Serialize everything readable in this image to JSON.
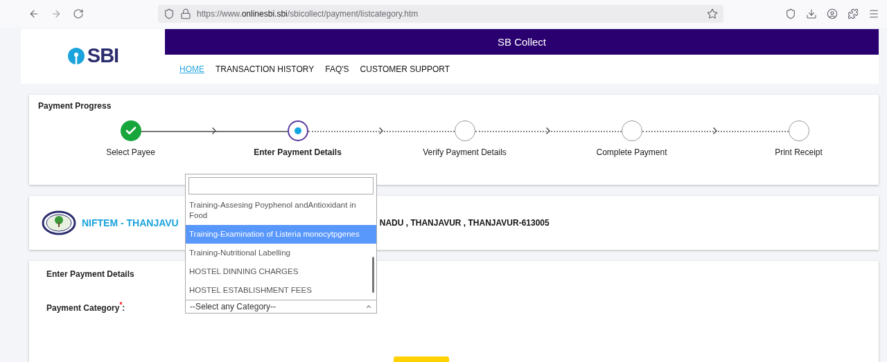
{
  "browser": {
    "url_prefix": "https://www.",
    "url_host": "onlinesbi.sbi",
    "url_path": "/sbicollect/payment/listcategory.htm"
  },
  "header": {
    "logo_text": "SBI",
    "banner_title": "SB Collect",
    "nav": [
      {
        "label": "HOME",
        "selected": true
      },
      {
        "label": "TRANSACTION HISTORY",
        "selected": false
      },
      {
        "label": "FAQ'S",
        "selected": false
      },
      {
        "label": "CUSTOMER SUPPORT",
        "selected": false
      }
    ]
  },
  "progress": {
    "title": "Payment Progress",
    "steps": [
      {
        "label": "Select Payee",
        "kind": "done"
      },
      {
        "label": "Enter Payment Details",
        "kind": "current"
      },
      {
        "label": "Verify Payment Details",
        "kind": "pending"
      },
      {
        "label": "Complete Payment",
        "kind": "pending"
      },
      {
        "label": "Print Receipt",
        "kind": "pending"
      }
    ]
  },
  "institution": {
    "name": "NIFTEM - THANJAVU",
    "address": "NADU , THANJAVUR , THANJAVUR-613005"
  },
  "details": {
    "title": "Enter Payment Details",
    "category_label": "Payment Category",
    "required_mark": "*",
    "colon": ":",
    "select_value": "--Select any Category--",
    "dropdown": {
      "options": [
        {
          "label": "Training-Assesing Poyphenol andAntioxidant in Food",
          "selected": false
        },
        {
          "label": "Training-Examination of Listeria monocytpgenes",
          "selected": true
        },
        {
          "label": "Training-Nutritional Labelling",
          "selected": false
        },
        {
          "label": "HOSTEL DINNING CHARGES",
          "selected": false
        },
        {
          "label": "HOSTEL ESTABLISHMENT FEES",
          "selected": false
        }
      ]
    }
  }
}
